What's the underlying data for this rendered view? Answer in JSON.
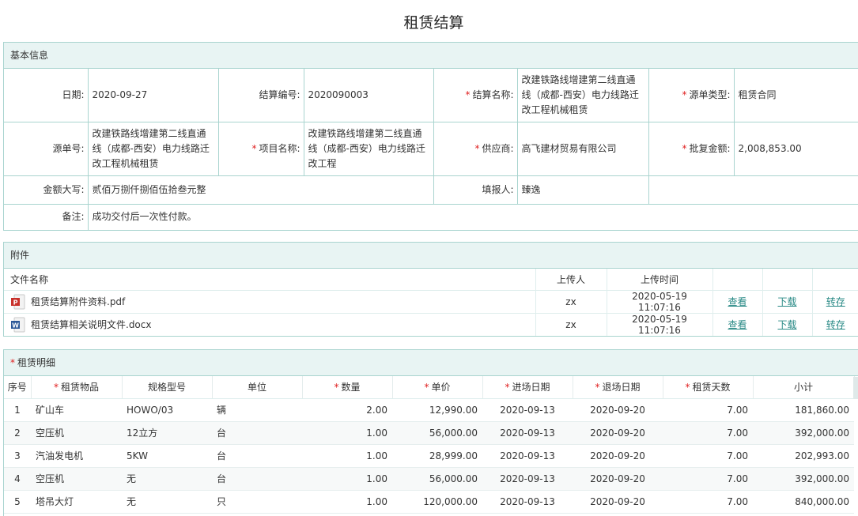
{
  "page_title": "租赁结算",
  "basic": {
    "heading": "基本信息",
    "date_label": "日期:",
    "date": "2020-09-27",
    "settle_no_label": "结算编号:",
    "settle_no": "2020090003",
    "settle_name_label": "结算名称:",
    "settle_name": "改建铁路线增建第二线直通线（成都-西安）电力线路迁改工程机械租赁",
    "source_type_label": "源单类型:",
    "source_type": "租赁合同",
    "source_no_label": "源单号:",
    "source_no": "改建铁路线增建第二线直通线（成都-西安）电力线路迁改工程机械租赁",
    "project_label": "项目名称:",
    "project": "改建铁路线增建第二线直通线（成都-西安）电力线路迁改工程",
    "supplier_label": "供应商:",
    "supplier": "高飞建材贸易有限公司",
    "approved_label": "批复金额:",
    "approved": "2,008,853.00",
    "amount_cn_label": "金额大写:",
    "amount_cn": "贰佰万捌仟捌佰伍拾叁元整",
    "filler_label": "填报人:",
    "filler": "臻逸",
    "remark_label": "备注:",
    "remark": "成功交付后一次性付款。"
  },
  "attachments": {
    "heading": "附件",
    "col_name": "文件名称",
    "col_uploader": "上传人",
    "col_time": "上传时间",
    "view_label": "查看",
    "download_label": "下载",
    "transfer_label": "转存",
    "files": [
      {
        "icon": "pdf-file-icon",
        "name": "租赁结算附件资料.pdf",
        "uploader": "zx",
        "time": "2020-05-19 11:07:16"
      },
      {
        "icon": "word-file-icon",
        "name": "租赁结算相关说明文件.docx",
        "uploader": "zx",
        "time": "2020-05-19 11:07:16"
      }
    ]
  },
  "detail": {
    "heading": "租赁明细",
    "cols": {
      "seq": "序号",
      "item": "租赁物品",
      "spec": "规格型号",
      "unit": "单位",
      "qty": "数量",
      "price": "单价",
      "in_date": "进场日期",
      "out_date": "退场日期",
      "days": "租赁天数",
      "subtotal": "小计"
    },
    "rows": [
      {
        "seq": "1",
        "item": "矿山车",
        "spec": "HOWO/03",
        "unit": "辆",
        "qty": "2.00",
        "price": "12,990.00",
        "in_date": "2020-09-13",
        "out_date": "2020-09-20",
        "days": "7.00",
        "subtotal": "181,860.00"
      },
      {
        "seq": "2",
        "item": "空压机",
        "spec": "12立方",
        "unit": "台",
        "qty": "1.00",
        "price": "56,000.00",
        "in_date": "2020-09-13",
        "out_date": "2020-09-20",
        "days": "7.00",
        "subtotal": "392,000.00"
      },
      {
        "seq": "3",
        "item": "汽油发电机",
        "spec": "5KW",
        "unit": "台",
        "qty": "1.00",
        "price": "28,999.00",
        "in_date": "2020-09-13",
        "out_date": "2020-09-20",
        "days": "7.00",
        "subtotal": "202,993.00"
      },
      {
        "seq": "4",
        "item": "空压机",
        "spec": "无",
        "unit": "台",
        "qty": "1.00",
        "price": "56,000.00",
        "in_date": "2020-09-13",
        "out_date": "2020-09-20",
        "days": "7.00",
        "subtotal": "392,000.00"
      },
      {
        "seq": "5",
        "item": "塔吊大灯",
        "spec": "无",
        "unit": "只",
        "qty": "1.00",
        "price": "120,000.00",
        "in_date": "2020-09-13",
        "out_date": "2020-09-20",
        "days": "7.00",
        "subtotal": "840,000.00"
      }
    ]
  },
  "colors": {
    "accent": "#2a8a86",
    "border": "#a9d4cf",
    "header_bg": "#e8f4f3",
    "required": "#e02020"
  }
}
